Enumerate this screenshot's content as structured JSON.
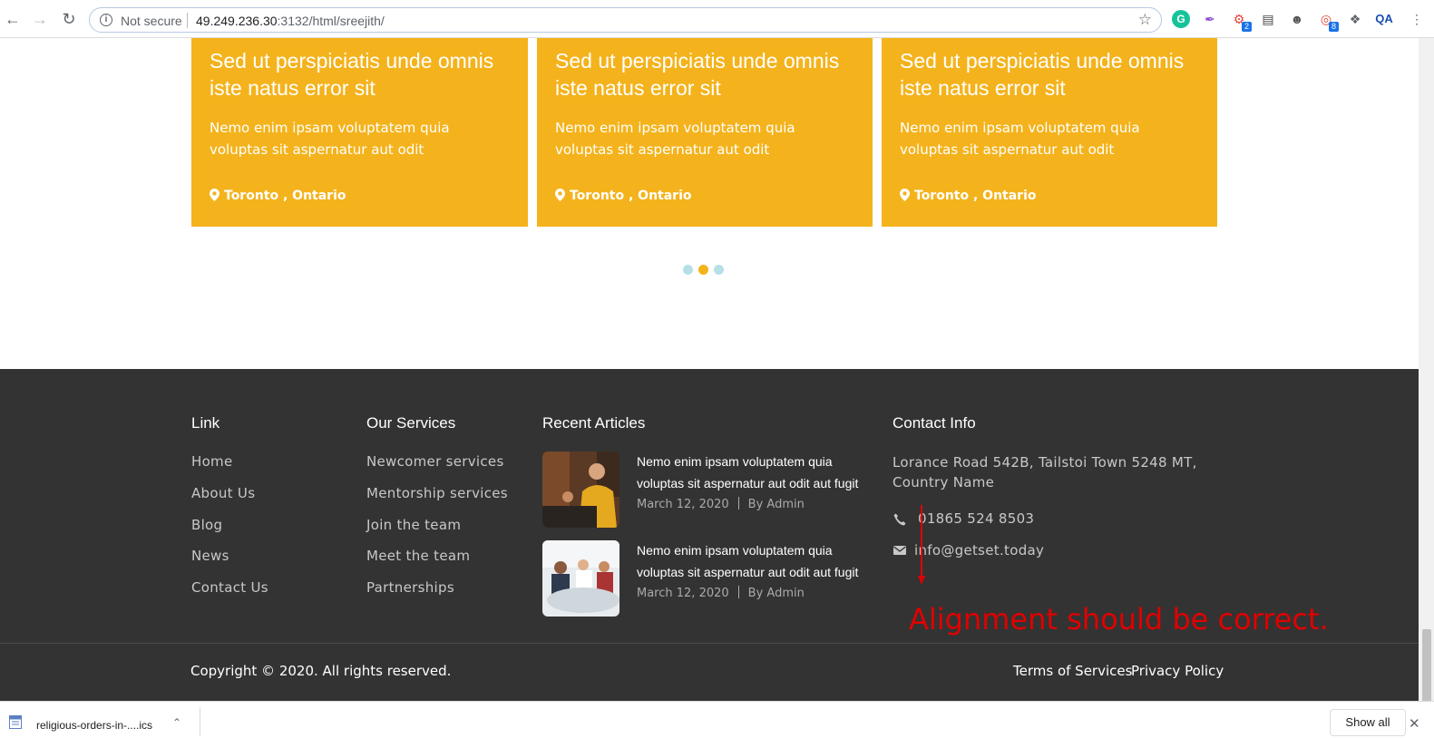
{
  "browser": {
    "not_secure": "Not secure",
    "url_host": "49.249.236.30",
    "url_rest": ":3132/html/sreejith/",
    "ext_badge_1": "2",
    "ext_badge_2": "8",
    "ext_qa": "QA"
  },
  "cards": [
    {
      "title": "Sed ut perspiciatis unde omnis iste natus error sit",
      "desc": "Nemo enim ipsam voluptatem quia voluptas sit aspernatur aut odit",
      "location": "Toronto , Ontario"
    },
    {
      "title": "Sed ut perspiciatis unde omnis iste natus error sit",
      "desc": "Nemo enim ipsam voluptatem quia voluptas sit aspernatur aut odit",
      "location": "Toronto , Ontario"
    },
    {
      "title": "Sed ut perspiciatis unde omnis iste natus error sit",
      "desc": "Nemo enim ipsam voluptatem quia voluptas sit aspernatur aut odit",
      "location": "Toronto , Ontario"
    }
  ],
  "carousel": {
    "active_index": 1,
    "count": 3
  },
  "footer": {
    "link_title": "Link",
    "links": [
      "Home",
      "About Us",
      "Blog",
      "News",
      "Contact Us"
    ],
    "services_title": "Our Services",
    "services": [
      "Newcomer services",
      "Mentorship services",
      "Join the team",
      "Meet the team",
      "Partnerships"
    ],
    "articles_title": "Recent Articles",
    "articles": [
      {
        "title": "Nemo enim ipsam voluptatem quia voluptas sit aspernatur aut odit aut fugit",
        "date": "March 12, 2020",
        "author": "By Admin"
      },
      {
        "title": "Nemo enim ipsam voluptatem quia voluptas sit aspernatur aut odit aut fugit",
        "date": "March 12, 2020",
        "author": "By Admin"
      }
    ],
    "contact_title": "Contact Info",
    "address": "Lorance Road 542B, Tailstoi Town 5248 MT, Country Name",
    "phone": "01865 524 8503",
    "email": "info@getset.today",
    "copyright": "Copyright © 2020. All rights reserved.",
    "terms": "Terms of Services",
    "privacy": "Privacy Policy"
  },
  "annotation": {
    "text": "Alignment should be correct.",
    "color": "#e00000"
  },
  "download": {
    "filename": "religious-orders-in-....ics",
    "show_all": "Show all"
  },
  "colors": {
    "accent": "#f4b31c",
    "footer_bg": "#333333",
    "dot_inactive": "#b6dfe7"
  }
}
